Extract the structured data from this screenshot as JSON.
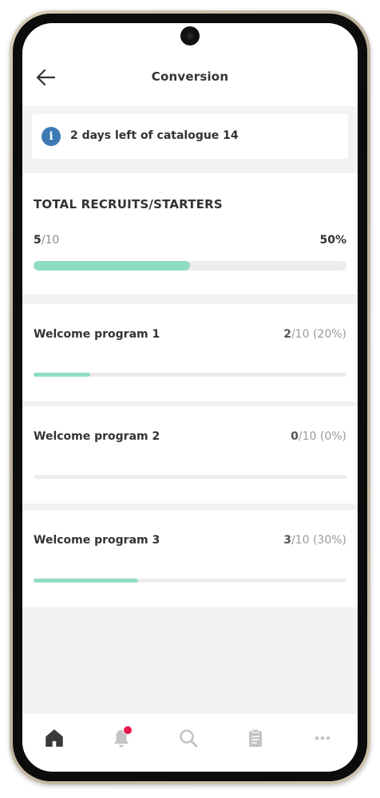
{
  "header": {
    "title": "Conversion"
  },
  "notice": {
    "text": "2 days left of catalogue 14"
  },
  "total": {
    "title": "TOTAL RECRUITS/STARTERS",
    "current": "5",
    "of": "/10",
    "percent_label": "50%",
    "progress": 0.5
  },
  "programs": [
    {
      "name": "Welcome program 1",
      "current": "2",
      "rest": "/10 (20%)",
      "progress": 0.18
    },
    {
      "name": "Welcome program 2",
      "current": "0",
      "rest": "/10 (0%)",
      "progress": 0
    },
    {
      "name": "Welcome program 3",
      "current": "3",
      "rest": "/10 (30%)",
      "progress": 0.335
    }
  ],
  "nav": {
    "items": [
      {
        "icon": "home-icon",
        "active": true
      },
      {
        "icon": "bell-icon",
        "badge": true
      },
      {
        "icon": "search-icon"
      },
      {
        "icon": "clipboard-icon"
      },
      {
        "icon": "more-icon"
      }
    ]
  },
  "colors": {
    "accent": "#8fdcc4",
    "info": "#3d7ab3",
    "badge": "#e5194a",
    "nav_active": "#3a3a3a",
    "nav_inactive": "#c4c4c4"
  }
}
